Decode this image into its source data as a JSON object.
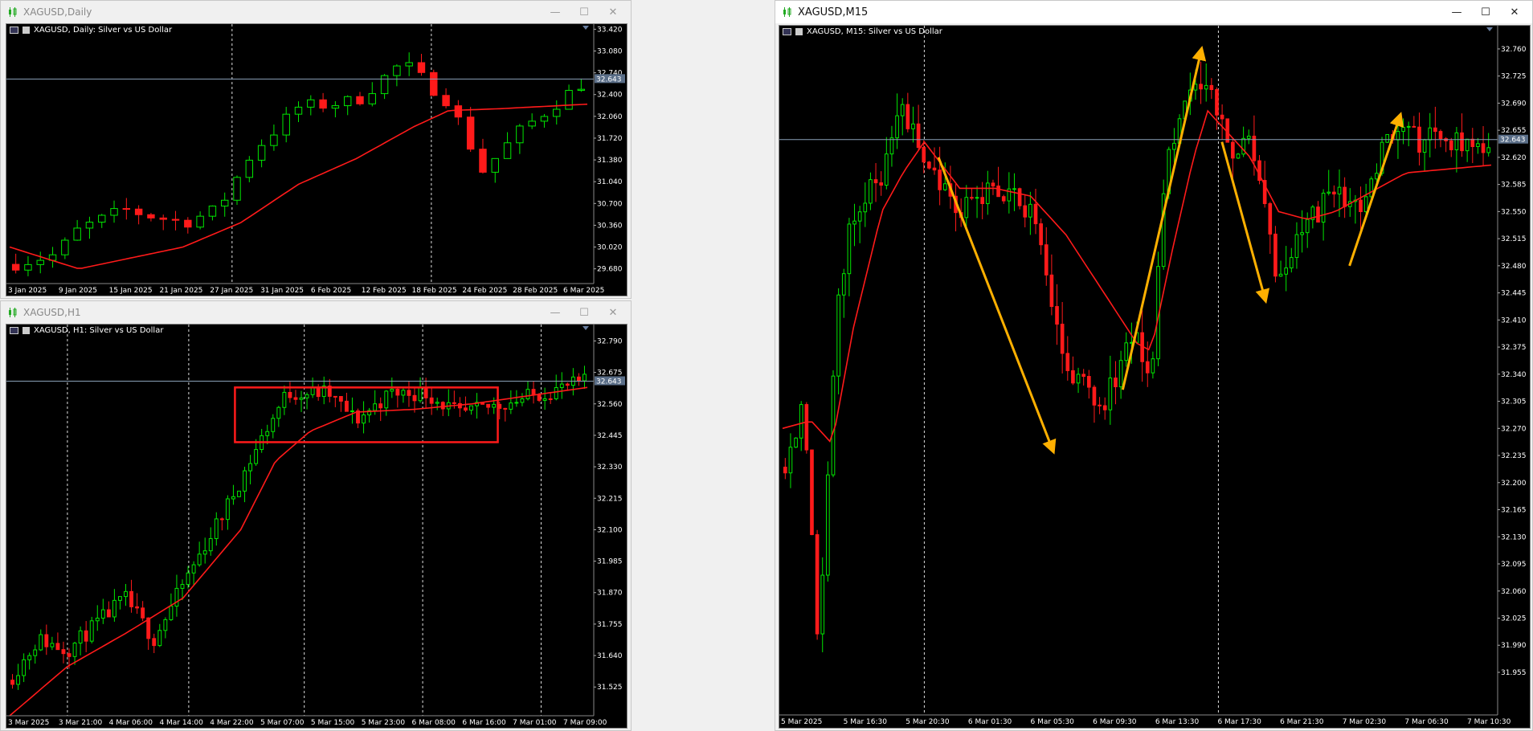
{
  "windows": {
    "daily": {
      "title": "XAGUSD,Daily",
      "chart_title": "XAGUSD, Daily:  Silver vs US Dollar",
      "current_price": "32.643"
    },
    "h1": {
      "title": "XAGUSD,H1",
      "chart_title": "XAGUSD, H1:  Silver vs US Dollar",
      "current_price": "32.643"
    },
    "m15": {
      "title": "XAGUSD,M15",
      "chart_title": "XAGUSD, M15:  Silver vs US Dollar",
      "current_price": "32.643"
    }
  },
  "window_controls": {
    "minimize": "—",
    "maximize": "☐",
    "close": "✕"
  },
  "colors": {
    "bull": "#00e600",
    "bear": "#ff1a1a",
    "ma": "#ff1a1a",
    "arrow": "#ffb000",
    "box": "#ff1a1a",
    "grid": "#c8c8c8"
  },
  "chart_data": [
    {
      "id": "daily",
      "type": "candlestick",
      "title": "XAGUSD, Daily:  Silver vs US Dollar",
      "ylim": [
        29.45,
        33.5
      ],
      "y_ticks": [
        "33.420",
        "33.080",
        "32.740",
        "32.400",
        "32.060",
        "31.720",
        "31.380",
        "31.040",
        "30.700",
        "30.360",
        "30.020",
        "29.680"
      ],
      "x_ticks": [
        "3 Jan 2025",
        "9 Jan 2025",
        "15 Jan 2025",
        "21 Jan 2025",
        "27 Jan 2025",
        "31 Jan 2025",
        "6 Feb 2025",
        "12 Feb 2025",
        "18 Feb 2025",
        "24 Feb 2025",
        "28 Feb 2025",
        "6 Mar 2025"
      ],
      "current_price": 32.643,
      "indicator": "moving average"
    },
    {
      "id": "h1",
      "type": "candlestick",
      "title": "XAGUSD, H1:  Silver vs US Dollar",
      "ylim": [
        31.42,
        32.85
      ],
      "y_ticks": [
        "32.790",
        "32.675",
        "32.560",
        "32.445",
        "32.330",
        "32.215",
        "32.100",
        "31.985",
        "31.870",
        "31.755",
        "31.640",
        "31.525"
      ],
      "x_ticks": [
        "3 Mar 2025",
        "3 Mar 21:00",
        "4 Mar 06:00",
        "4 Mar 14:00",
        "4 Mar 22:00",
        "5 Mar 07:00",
        "5 Mar 15:00",
        "5 Mar 23:00",
        "6 Mar 08:00",
        "6 Mar 16:00",
        "7 Mar 01:00",
        "7 Mar 09:00"
      ],
      "current_price": 32.643,
      "indicator": "moving average",
      "annotation": "consolidation box"
    },
    {
      "id": "m15",
      "type": "candlestick",
      "title": "XAGUSD, M15:  Silver vs US Dollar",
      "ylim": [
        31.9,
        32.79
      ],
      "y_ticks": [
        "32.760",
        "32.725",
        "32.690",
        "32.655",
        "32.620",
        "32.585",
        "32.550",
        "32.515",
        "32.480",
        "32.445",
        "32.410",
        "32.375",
        "32.340",
        "32.305",
        "32.270",
        "32.235",
        "32.200",
        "32.165",
        "32.130",
        "32.095",
        "32.060",
        "32.025",
        "31.990",
        "31.955"
      ],
      "x_ticks": [
        "5 Mar 2025",
        "5 Mar 16:30",
        "5 Mar 20:30",
        "6 Mar 01:30",
        "6 Mar 05:30",
        "6 Mar 09:30",
        "6 Mar 13:30",
        "6 Mar 17:30",
        "6 Mar 21:30",
        "7 Mar 02:30",
        "7 Mar 06:30",
        "7 Mar 10:30"
      ],
      "current_price": 32.643,
      "indicator": "moving average",
      "annotation": "trend arrows"
    }
  ]
}
